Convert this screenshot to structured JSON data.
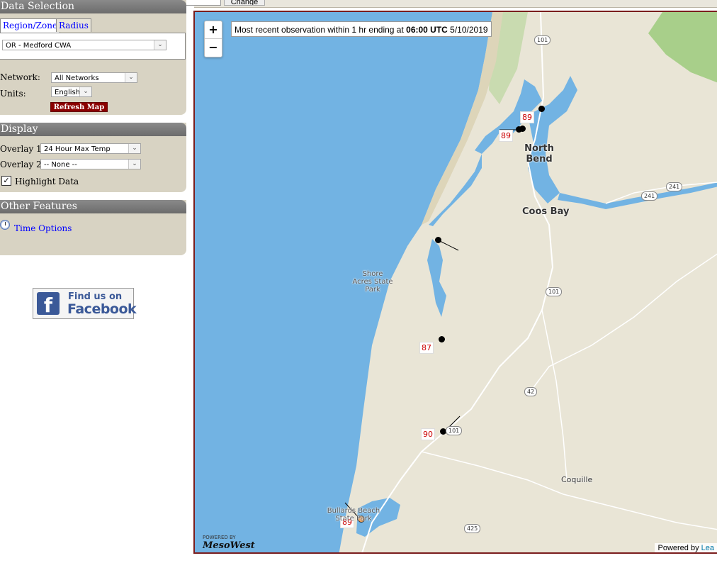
{
  "top": {
    "change_button": "Change"
  },
  "data_selection": {
    "header": "Data Selection",
    "tabs": [
      "Region/Zone",
      "Radius"
    ],
    "region_value": "OR - Medford CWA",
    "network_label": "Network:",
    "network_value": "All Networks",
    "units_label": "Units:",
    "units_value": "English",
    "refresh_label": "Refresh Map"
  },
  "display": {
    "header": "Display",
    "overlay1_label": "Overlay 1:",
    "overlay1_value": "24 Hour Max Temp",
    "overlay2_label": "Overlay 2:",
    "overlay2_value": "-- None --",
    "highlight_label": "Highlight Data",
    "highlight_checked": true
  },
  "other": {
    "header": "Other Features",
    "time_options": "Time Options"
  },
  "facebook": {
    "line1": "Find us on",
    "line2": "Facebook"
  },
  "map": {
    "zoom_in": "+",
    "zoom_out": "−",
    "obs_prefix": "Most recent observation within 1 hr ending at ",
    "obs_time": "06:00 UTC",
    "obs_date": " 5/10/2019",
    "values": [
      "89",
      "89",
      "87",
      "90",
      "89"
    ],
    "places": {
      "north_bend": "North Bend",
      "coos_bay": "Coos Bay",
      "shore_acres": "Shore Acres State Park",
      "coquille": "Coquille",
      "bullards": "Bullards Beach State Park"
    },
    "shields": [
      "101",
      "241",
      "241",
      "101",
      "42",
      "101",
      "425"
    ],
    "powered_small": "POWERED BY",
    "powered_big": "MesoWest",
    "attribution_prefix": "Powered by ",
    "attribution_link": "Lea"
  },
  "colors": {
    "water": "#72b3e3",
    "land": "#e8e4d6",
    "header": "#7a7a7a",
    "panel": "#d8d3c3",
    "refresh": "#8b0000"
  }
}
